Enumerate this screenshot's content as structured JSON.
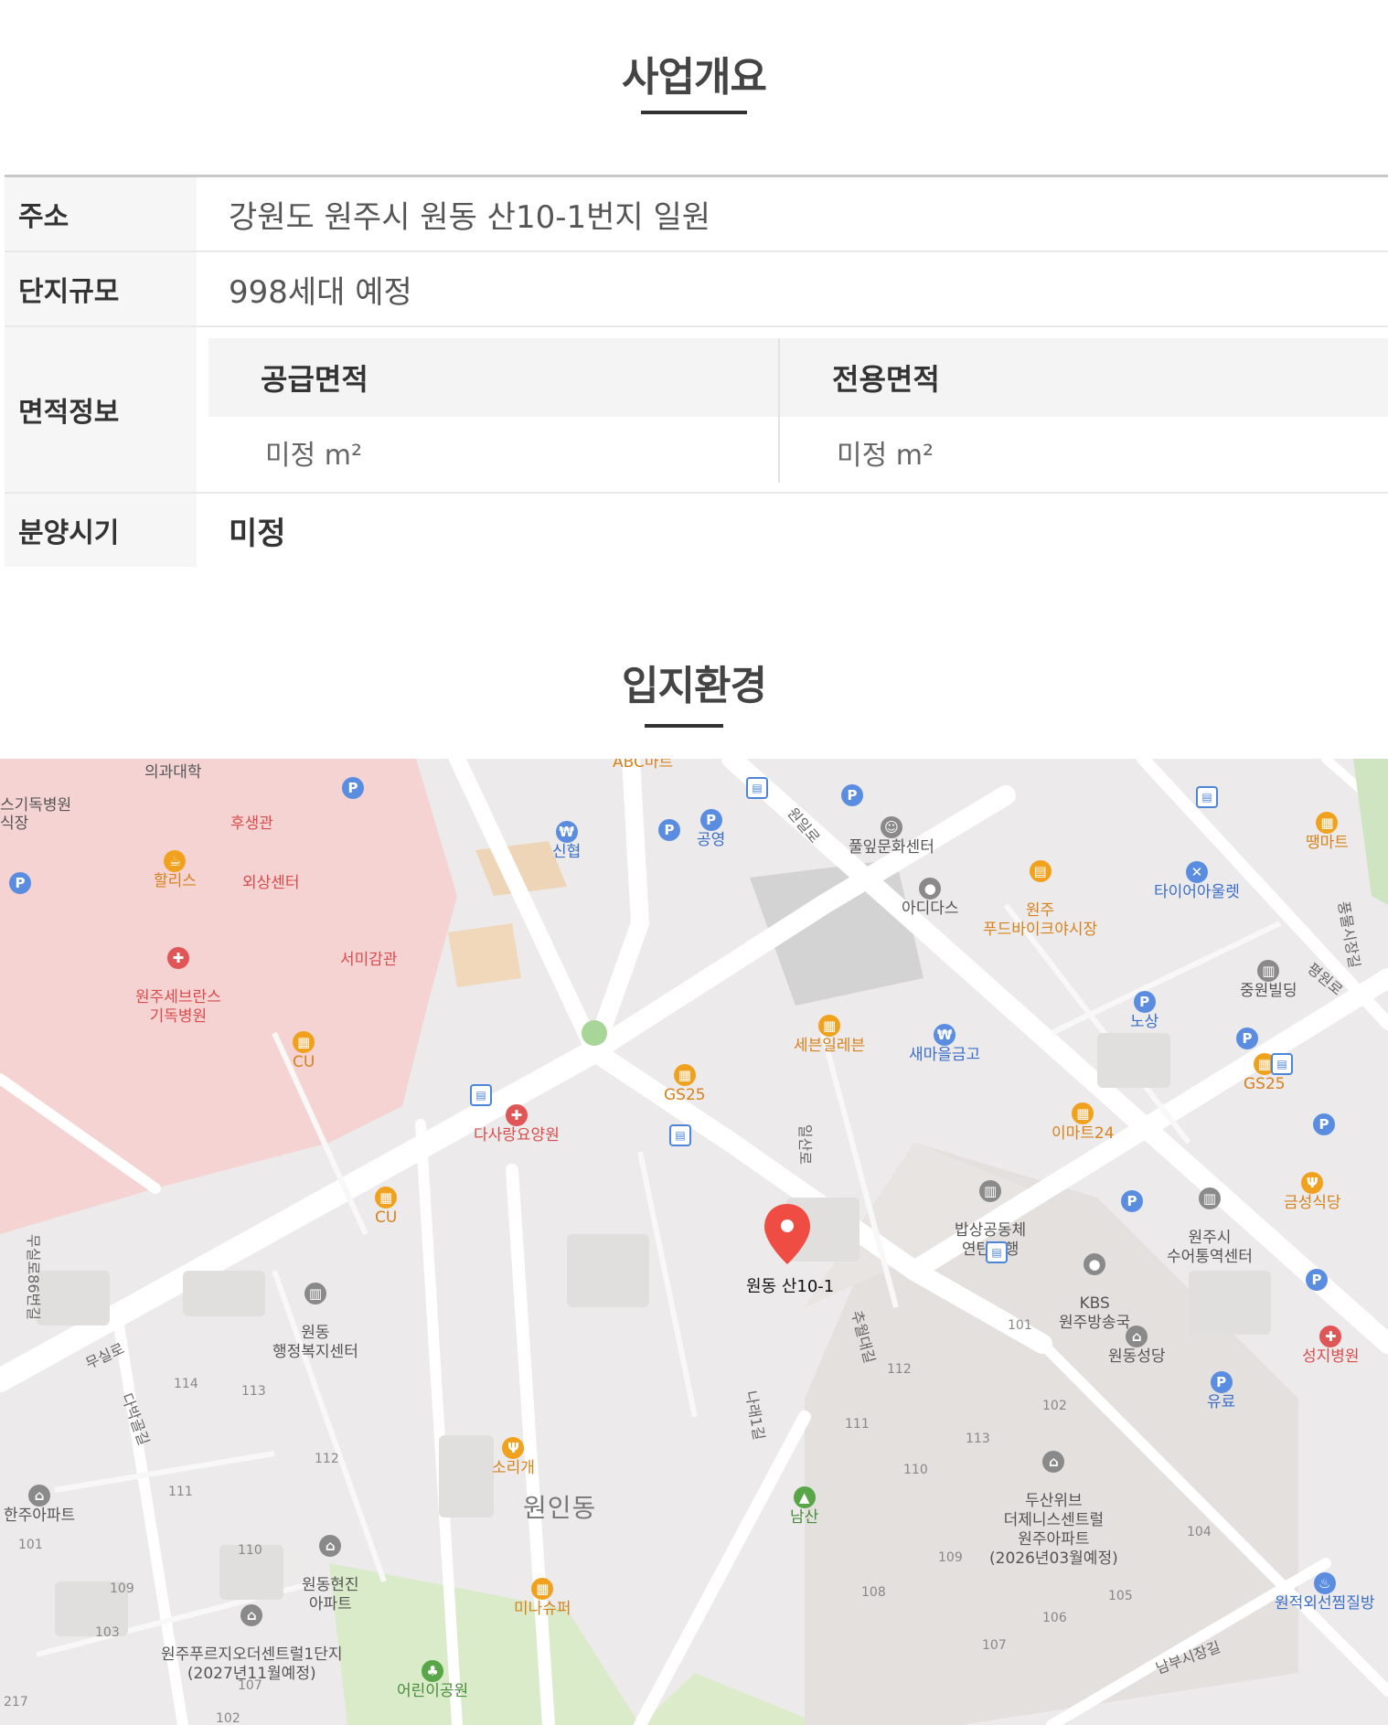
{
  "overview": {
    "title": "사업개요",
    "rows": {
      "address": {
        "label": "주소",
        "value": "강원도 원주시 원동 산10-1번지 일원"
      },
      "scale": {
        "label": "단지규모",
        "value": "998세대 예정"
      },
      "area": {
        "label": "면적정보",
        "supply_label": "공급면적",
        "supply_value": "미정 m²",
        "exclusive_label": "전용면적",
        "exclusive_value": "미정 m²"
      },
      "sale": {
        "label": "분양시기",
        "value": "미정"
      }
    }
  },
  "location": {
    "title": "입지환경",
    "marker_label": "원동 산10-1",
    "pois": {
      "sejong": "의과대학",
      "severance": "스기독병원",
      "sikjang": "식장",
      "husaenggwan": "후생관",
      "hallis": "할리스",
      "oesang": "외상센터",
      "severance2": "원주세브란스\n기독병원",
      "semigam": "서미감관",
      "cu1": "CU",
      "abc": "ABC마트",
      "sinhyeop": "신협",
      "gongyeong": "공영",
      "pulip": "풀잎문화센터",
      "adidas": "아디다스",
      "food": "원주\n푸드바이크야시장",
      "tire": "타이어아울렛",
      "ttaemart": "땡마트",
      "jungwon": "중원빌딩",
      "nosang": "노상",
      "seven": "세븐일레븐",
      "saemaeul": "새마을금고",
      "gs25a": "GS25",
      "gs25b": "GS25",
      "emart": "이마트24",
      "dasarang": "다사랑요양원",
      "cu2": "CU",
      "babsang": "밥상공동체\n연탄은행",
      "suo": "원주시\n수어통역센터",
      "geumseong": "금성식당",
      "kbs": "KBS\n원주방송국",
      "wondong_office": "원동\n행정복지센터",
      "wondong_church": "원동성당",
      "seongji": "성지병원",
      "yuryo": "유료",
      "sorigae": "소리개",
      "wonin": "원인동",
      "namsan": "남산",
      "doosan": "두산위브\n더제니스센트럴\n원주아파트\n(2026년03월예정)",
      "hanju": "한주아파트",
      "hyeonjin": "원동현진\n아파트",
      "prugio": "원주푸르지오더센트럴1단지\n(2027년11월예정)",
      "minashu": "미나슈퍼",
      "children": "어린이공원",
      "jjimjil": "원적외선찜질방"
    },
    "roads": {
      "musilro": "무실로",
      "musilro86": "무실로86번길",
      "dabakgol": "다박골길",
      "ilsanro": "일산로",
      "wonillo": "원일로",
      "pyeongwonro": "평원로",
      "pungmul": "풍물시장길",
      "chuwol": "추월대길",
      "narae": "나래1길",
      "nambu": "남부시장길"
    }
  }
}
